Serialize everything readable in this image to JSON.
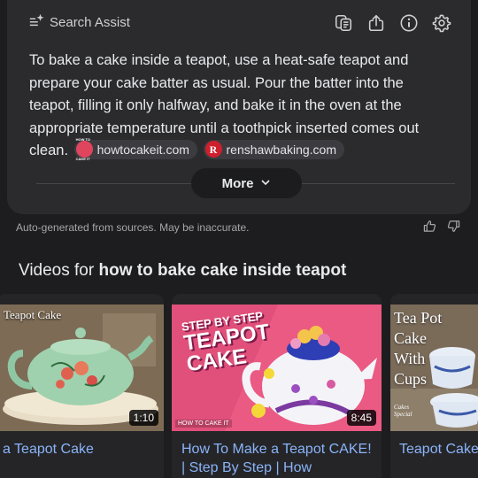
{
  "assist": {
    "title": "Search Assist",
    "answer_text": "To bake a cake inside a teapot, use a heat-safe teapot and prepare your cake batter as usual. Pour the batter into the teapot, filling it only halfway, and bake it in the oven at the appropriate temperature until a toothpick inserted comes out clean.",
    "sources": [
      {
        "label": "howtocakeit.com",
        "logo_text": "HOW TO CAKE IT"
      },
      {
        "label": "renshawbaking.com",
        "logo_text": "R"
      }
    ],
    "more_label": "More",
    "icons": [
      "copy-icon",
      "share-icon",
      "info-icon",
      "settings-icon"
    ]
  },
  "disclaimer": "Auto-generated from sources. May be inaccurate.",
  "videos": {
    "heading_prefix": "Videos for ",
    "heading_query": "how to bake cake inside teapot",
    "items": [
      {
        "title": "a Teapot Cake",
        "duration": "1:10",
        "thumb_label": "Teapot Cake"
      },
      {
        "title": "How To Make a Teapot CAKE! | Step By Step | How",
        "duration": "8:45",
        "thumb_line1": "STEP BY STEP",
        "thumb_line2": "TEAPOT",
        "thumb_line3": "CAKE",
        "brand": "HOW TO CAKE IT"
      },
      {
        "title": "Teapot Cake",
        "thumb_label": "Tea Pot Cake With Cups",
        "thumb_sign": "Cakes Special"
      }
    ]
  },
  "colors": {
    "background": "#1d1d1f",
    "card": "#2b2b2e",
    "link": "#8ab4f8"
  }
}
